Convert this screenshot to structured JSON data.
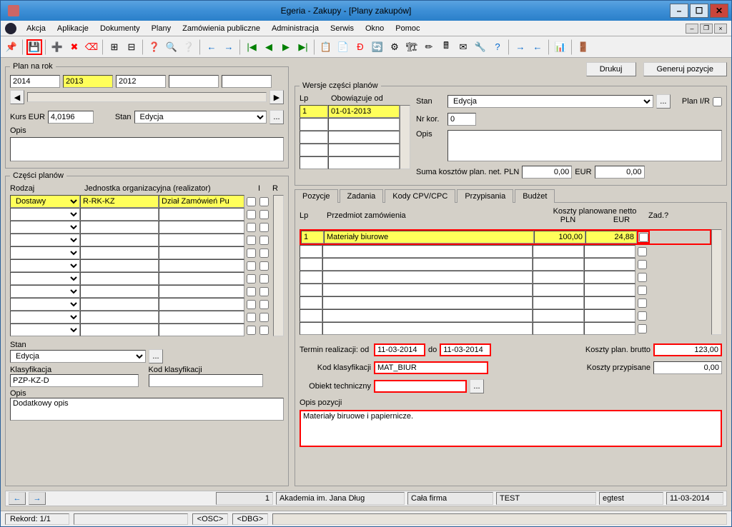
{
  "title": "Egeria - Zakupy - [Plany zakupów]",
  "menu": [
    "Akcja",
    "Aplikacje",
    "Dokumenty",
    "Plany",
    "Zamówienia publiczne",
    "Administracja",
    "Serwis",
    "Okno",
    "Pomoc"
  ],
  "buttons": {
    "drukuj": "Drukuj",
    "generuj": "Generuj pozycje"
  },
  "planNaRok": {
    "legend": "Plan na rok",
    "years": [
      "2014",
      "2013",
      "2012",
      "",
      ""
    ],
    "kursLabel": "Kurs EUR",
    "kurs": "4,0196",
    "stanLabel": "Stan",
    "stan": "Edycja",
    "opisLabel": "Opis",
    "opis": ""
  },
  "czesci": {
    "legend": "Części planów",
    "headers": {
      "rodzaj": "Rodzaj",
      "jednostka": "Jednostka organizacyjna (realizator)",
      "I": "I",
      "R": "R"
    },
    "rows": [
      {
        "rodzaj": "Dostawy",
        "kod": "R-RK-KZ",
        "nazwa": "Dział Zamówień Pu"
      }
    ],
    "stanLabel": "Stan",
    "stan": "Edycja",
    "klasLabel": "Klasyfikacja",
    "klas": "PZP-KZ-D",
    "kodKlasLabel": "Kod klasyfikacji",
    "kodKlas": "",
    "opisLabel": "Opis",
    "opis": "Dodatkowy opis"
  },
  "wersje": {
    "legend": "Wersje części planów",
    "lpHdr": "Lp",
    "obHdr": "Obowiązuje od",
    "lp": "1",
    "ob": "01-01-2013",
    "stanLabel": "Stan",
    "stan": "Edycja",
    "nrKorLabel": "Nr kor.",
    "nrKor": "0",
    "opisLabel": "Opis",
    "opis": "",
    "sumaLabel": "Suma kosztów plan. net. PLN",
    "sumaPln": "0,00",
    "sumaEurLbl": "EUR",
    "sumaEur": "0,00",
    "planIRLabel": "Plan I/R"
  },
  "tabs": [
    "Pozycje",
    "Zadania",
    "Kody CPV/CPC",
    "Przypisania",
    "Budżet"
  ],
  "pozycje": {
    "hdrLp": "Lp",
    "hdrPrzedmiot": "Przedmiot zamówienia",
    "hdrKoszty": "Koszty planowane netto",
    "hdrPln": "PLN",
    "hdrEur": "EUR",
    "hdrZad": "Zad.?",
    "row": {
      "lp": "1",
      "przedmiot": "Materiały biurowe",
      "pln": "100,00",
      "eur": "24,88"
    },
    "terminLabel": "Termin realizacji: od",
    "terminOd": "11-03-2014",
    "terminDoLbl": "do",
    "terminDo": "11-03-2014",
    "kodKlasLabel": "Kod klasyfikacji",
    "kodKlas": "MAT_BIUR",
    "obiektLabel": "Obiekt techniczny",
    "obiekt": "",
    "opisLabel": "Opis pozycji",
    "opis": "Materiały biruowe i papiernicze.",
    "bruttoLabel": "Koszty plan. brutto",
    "brutto": "123,00",
    "przypLabel": "Koszty przypisane",
    "przyp": "0,00"
  },
  "nav": {
    "n1": "1",
    "n2": "Akademia im. Jana Dług",
    "n3": "Cała firma",
    "n4": "TEST",
    "n5": "egtest",
    "n6": "11-03-2014"
  },
  "status": {
    "rekord": "Rekord: 1/1",
    "osc": "<OSC>",
    "dbg": "<DBG>"
  }
}
